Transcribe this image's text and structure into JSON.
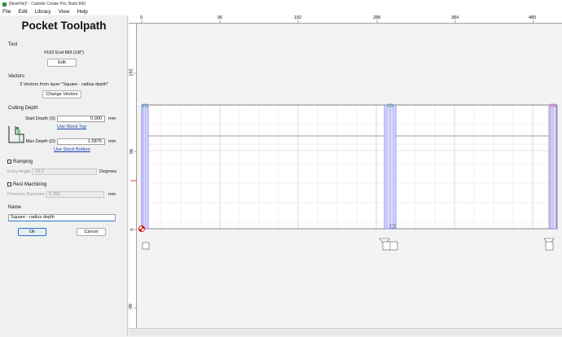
{
  "window": {
    "title": "[NewFile]* - Carbide Create Pro, Build 843"
  },
  "menu": [
    "File",
    "Edit",
    "Library",
    "View",
    "Help"
  ],
  "panel": {
    "title": "Pocket Toolpath",
    "tool": {
      "heading": "Tool",
      "name": "#102 End Mill (1/8\")",
      "edit_label": "Edit"
    },
    "vectors": {
      "heading": "Vectors",
      "summary": "3 Vectors from layer \"Square - radius depth\"",
      "change_label": "Change Vectors"
    },
    "cutting_depth": {
      "heading": "Cutting Depth",
      "start_label": "Start Depth (S)",
      "start_value": "0.000",
      "start_unit": "mm",
      "use_stock_top": "Use Stock Top",
      "max_label": "Max Depth (D)",
      "max_value": "1.5875",
      "max_unit": "mm",
      "use_stock_bottom": "Use Stock Bottom"
    },
    "ramping": {
      "label": "Ramping",
      "checked": false,
      "entry_angle_label": "Entry Angle",
      "entry_angle_value": "20.0",
      "entry_angle_unit": "Degrees"
    },
    "rest": {
      "label": "Rest Machining",
      "checked": false,
      "prev_diam_label": "Previous Diameter",
      "prev_diam_value": "6.350",
      "prev_diam_unit": "mm"
    },
    "name": {
      "heading": "Name",
      "value": "Square - radius depth"
    },
    "ok_label": "Ok",
    "cancel_label": "Cancel"
  },
  "rulers": {
    "top": [
      "0",
      "96",
      "192",
      "288",
      "384",
      "480"
    ],
    "left": [
      "192",
      "96",
      "0",
      "-96"
    ]
  },
  "colors": {
    "selection": "#7d7df5",
    "stock_outline": "#555555",
    "origin": "#e02020",
    "toolpath_end": "#e05050"
  }
}
